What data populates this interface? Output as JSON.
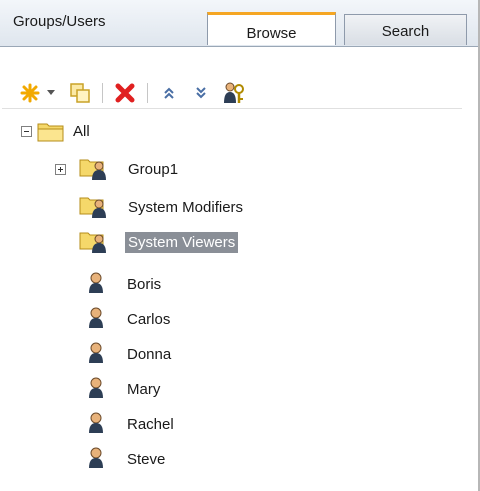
{
  "panel": {
    "title": "Groups/Users"
  },
  "tabs": [
    {
      "label": "Browse",
      "active": true
    },
    {
      "label": "Search",
      "active": false
    }
  ],
  "toolbar": {
    "items": [
      {
        "icon": "new-icon",
        "tooltip": ""
      },
      {
        "icon": "dropdown-arrow-icon"
      },
      {
        "icon": "copy-icon"
      },
      {
        "icon": "delete-icon"
      },
      {
        "icon": "collapse-all-icon"
      },
      {
        "icon": "expand-all-icon"
      },
      {
        "icon": "permissions-icon"
      }
    ]
  },
  "tree": {
    "root": {
      "label": "All",
      "expanded": true
    },
    "groups": [
      {
        "label": "Group1",
        "expandable": true,
        "expanded": false,
        "selected": false
      },
      {
        "label": "System Modifiers",
        "expandable": false,
        "selected": false
      },
      {
        "label": "System Viewers",
        "expandable": false,
        "selected": true
      }
    ],
    "users": [
      {
        "label": "Boris"
      },
      {
        "label": "Carlos"
      },
      {
        "label": "Donna"
      },
      {
        "label": "Mary"
      },
      {
        "label": "Rachel"
      },
      {
        "label": "Steve"
      }
    ]
  },
  "colors": {
    "active_tab_accent": "#f5a623",
    "selection_bg": "#8a8f97",
    "delete_red": "#e02020"
  }
}
